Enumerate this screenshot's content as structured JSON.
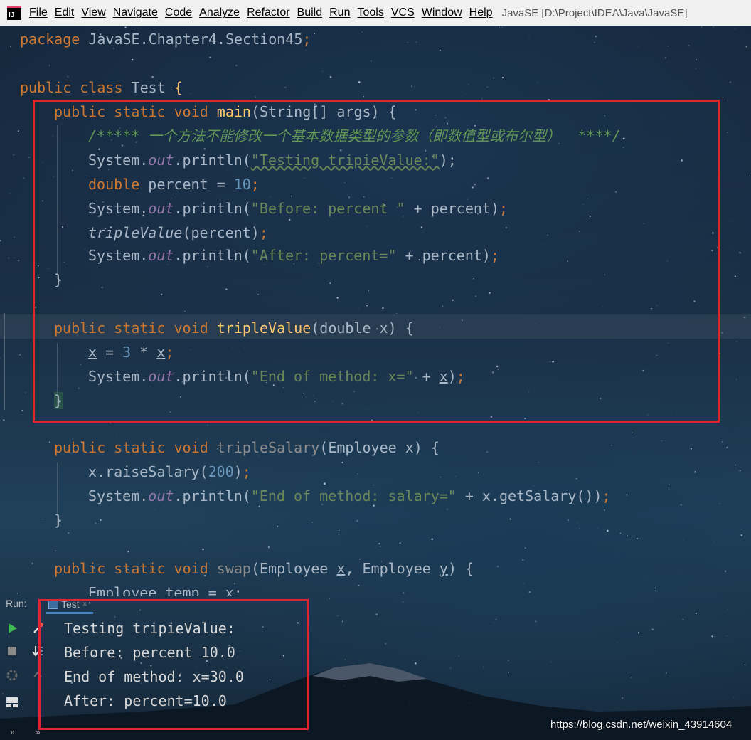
{
  "menubar": {
    "items": [
      "File",
      "Edit",
      "View",
      "Navigate",
      "Code",
      "Analyze",
      "Refactor",
      "Build",
      "Run",
      "Tools",
      "VCS",
      "Window",
      "Help"
    ],
    "title": "JavaSE [D:\\Project\\IDEA\\Java\\JavaSE]",
    "logo": "IJ"
  },
  "code": {
    "pkg": "package JavaSE.Chapter4.Section45;",
    "pkg_kw": "package",
    "pkg_name": " JavaSE.Chapter4.Section45",
    "class_kw": "public class",
    "class_name": " Test ",
    "main_sig_kw": "public static void",
    "main_name": "main",
    "main_params": "(String[] args) {",
    "comment": "/***** 一个方法不能修改一个基本数据类型的参数（即数值型或布尔型）  ****/",
    "sys": "System.",
    "out": "out",
    "println": ".println(",
    "s1": "\"Testing tripieValue:\"",
    "double_kw": "double",
    "percent_decl": " percent = ",
    "ten": "10",
    "s2": "\"Before: percent \"",
    "plus_percent": " + percent)",
    "triple_call": "tripleValue",
    "triple_args": "(percent)",
    "s3": "\"After: percent=\"",
    "close_brace": "}",
    "tv_name": "tripleValue",
    "tv_params": "(double x) {",
    "x_assign_a": "x",
    "x_assign_b": " = ",
    "three": "3",
    "x_assign_c": " * ",
    "x_assign_d": "x",
    "s4": "\"End of method: x=\"",
    "plus_x": " + ",
    "x_var": "x",
    "ts_name": "tripleSalary",
    "ts_params": "(Employee x) {",
    "raise": "x.raiseSalary(",
    "two_hundred": "200",
    "s5": "\"End of method: salary=\"",
    "get_salary": " + x.getSalary()",
    "swap_name": "swap",
    "swap_params_a": "(Employee ",
    "swap_params_b": ", Employee ",
    "swap_params_c": ") {",
    "partial": "Employee temp = x;"
  },
  "run": {
    "label": "Run:",
    "tab": "Test",
    "tab_close": "×",
    "output": [
      "Testing tripieValue:",
      "Before: percent 10.0",
      "End of method: x=30.0",
      "After: percent=10.0"
    ]
  },
  "watermark": "https://blog.csdn.net/weixin_43914604",
  "colors": {
    "keyword": "#cc7832",
    "method": "#ffc66d",
    "string": "#6a8759",
    "number": "#6897bb",
    "field": "#9876aa",
    "comment": "#629755",
    "highlight_box": "#e0262c"
  }
}
